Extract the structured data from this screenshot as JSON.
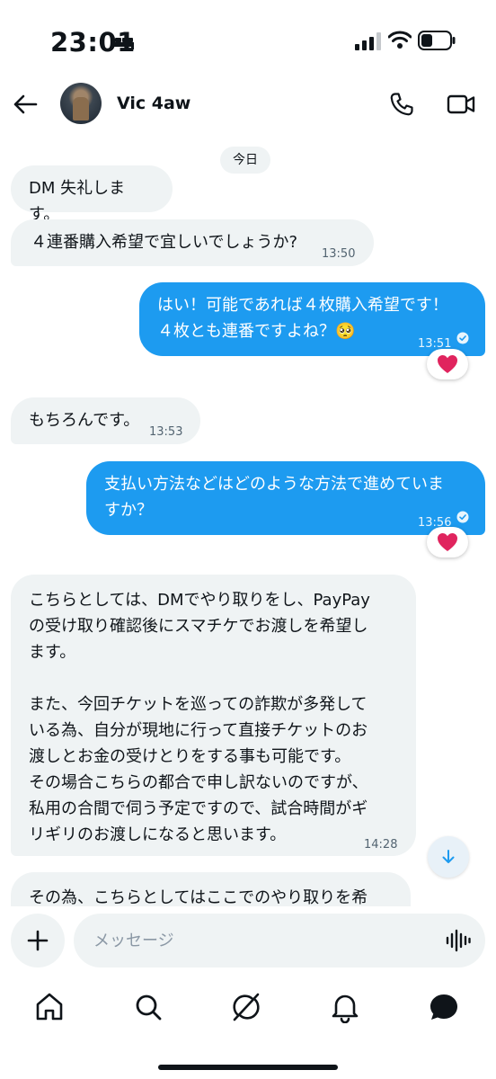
{
  "status_bar": {
    "time": "23:01",
    "icons": [
      "bed-icon",
      "signal-icon",
      "wifi-icon",
      "battery-icon"
    ]
  },
  "header": {
    "back_icon": "back-arrow-icon",
    "contact_name": "Vic 4aw",
    "actions": [
      "phone-icon",
      "video-call-icon"
    ]
  },
  "conversation": {
    "date_label": "今日",
    "messages": [
      {
        "direction": "in",
        "text": "DM 失礼します。",
        "time": ""
      },
      {
        "direction": "in",
        "text": "４連番購入希望で宜しいでしょうか?",
        "time": "13:50"
      },
      {
        "direction": "out",
        "text": "はい！可能であれば４枚購入希望です！\n４枚とも連番ですよね？🥺",
        "time": "13:51",
        "status": "read-check-icon",
        "reaction": "heart-icon"
      },
      {
        "direction": "in",
        "text": "もちろんです。",
        "time": "13:53"
      },
      {
        "direction": "out",
        "text": "支払い方法などはどのような方法で進めていま\nすか？",
        "time": "13:56",
        "status": "read-check-icon",
        "reaction": "heart-icon"
      },
      {
        "direction": "in",
        "text": "こちらとしては、DMでやり取りをし、PayPay\nの受け取り確認後にスマチケでお渡しを希望し\nます。\n\nまた、今回チケットを巡っての詐欺が多発して\nいる為、自分が現地に行って直接チケットのお\n渡しとお金の受けとりをする事も可能です。\nその場合こちらの都合で申し訳ないのですが、\n私用の合間で伺う予定ですので、試合時間がギ\nリギリのお渡しになると思います。",
        "time": "14:28"
      },
      {
        "direction": "in",
        "text": "その為、こちらとしてはここでのやり取りを希",
        "time": ""
      }
    ],
    "scroll_down_icon": "arrow-down-icon"
  },
  "composer": {
    "add_icon": "plus-icon",
    "placeholder": "メッセージ",
    "value": "",
    "voice_icon": "voice-wave-icon"
  },
  "tabbar": {
    "tabs": [
      "home-icon",
      "search-icon",
      "grok-icon",
      "notifications-icon",
      "messages-icon"
    ],
    "active": "messages-icon"
  },
  "colors": {
    "accent": "#1d9bf0",
    "incoming_bubble": "#eff3f4",
    "text": "#0f1419",
    "muted": "#536471",
    "reaction_heart": "#e0245e"
  }
}
